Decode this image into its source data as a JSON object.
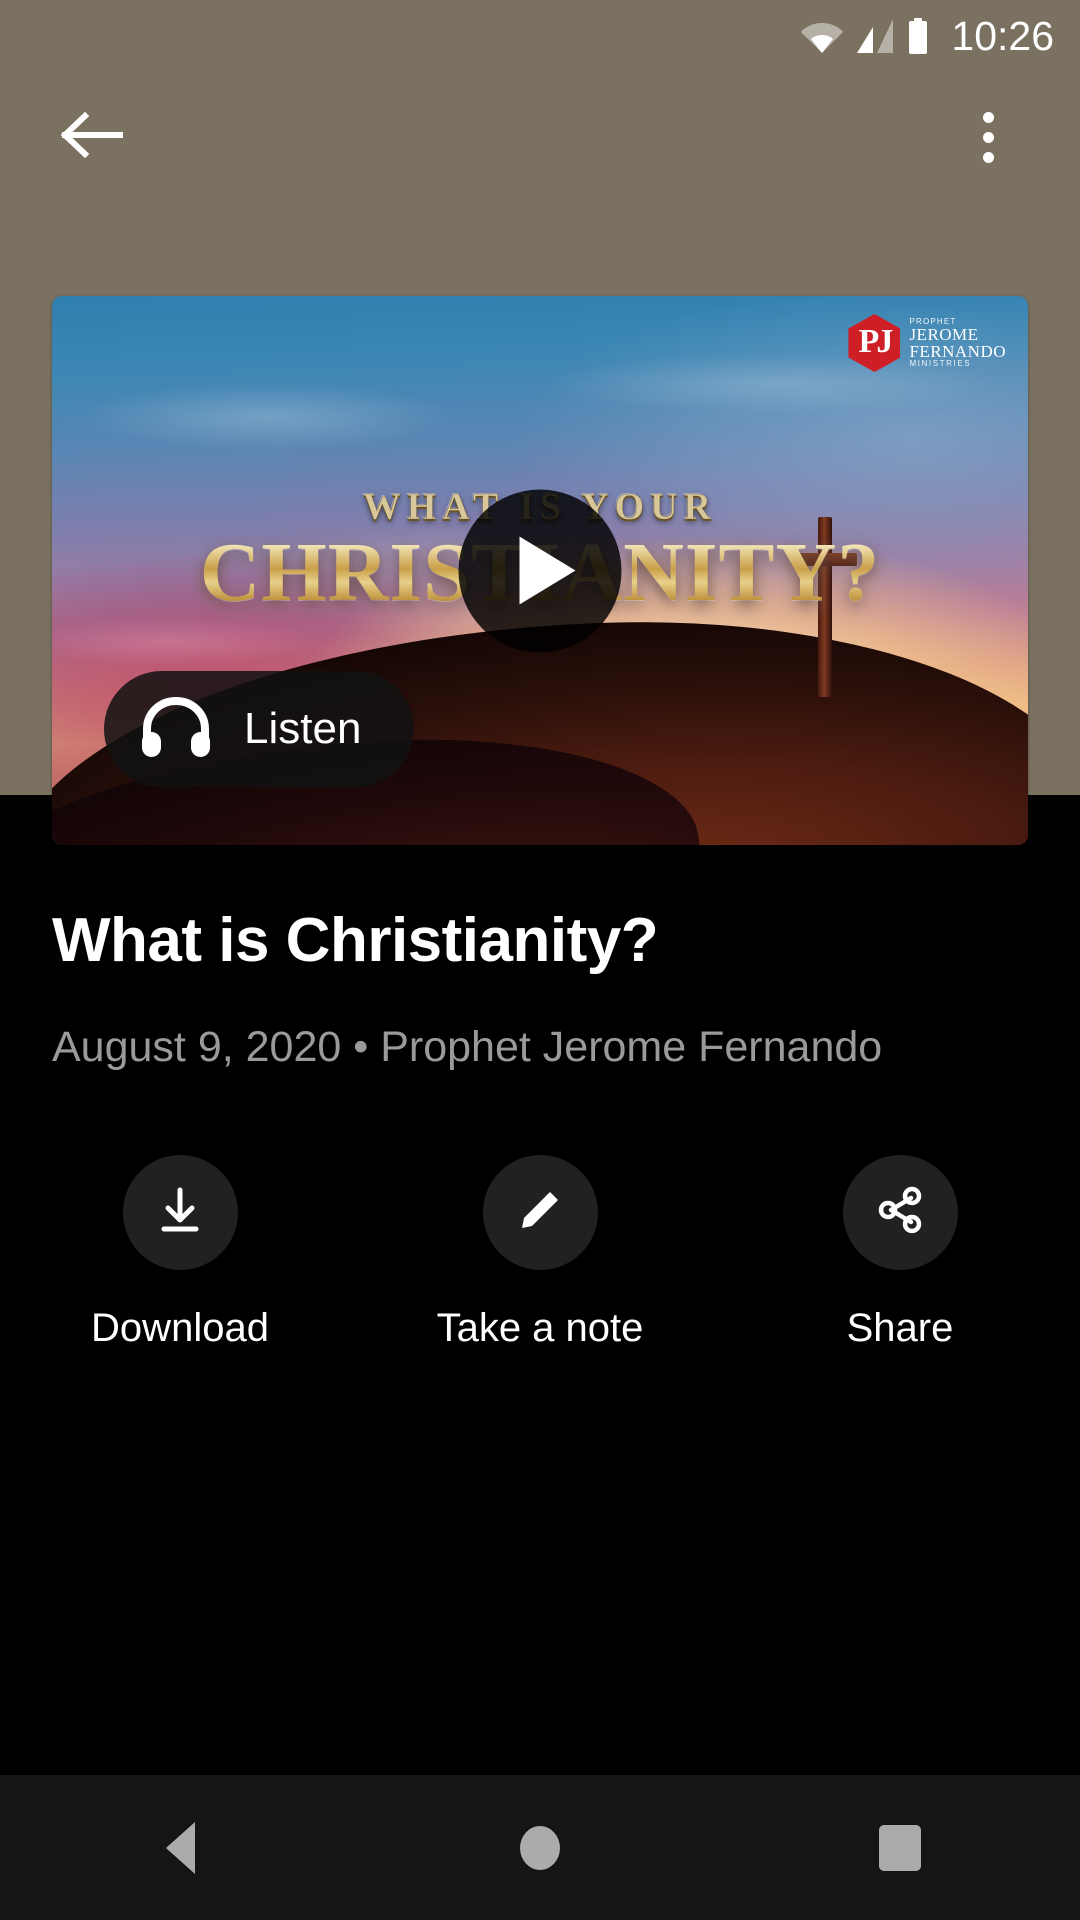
{
  "status_bar": {
    "time": "10:26",
    "icons": [
      "wifi-icon",
      "cellular-signal-icon",
      "battery-icon"
    ]
  },
  "app_bar": {
    "back_label": "Back",
    "back_icon": "arrow-left-icon",
    "overflow_icon": "more-vertical-icon",
    "overflow_label": "More options"
  },
  "video": {
    "play_icon": "play-icon",
    "play_label": "Play",
    "listen_label": "Listen",
    "listen_icon": "headphones-icon",
    "thumbnail": {
      "kicker": "WHAT IS YOUR",
      "headline": "CHRISTIANITY?",
      "logo": {
        "monogram": "PJ",
        "line1": "PROPHET",
        "line2": "JEROME",
        "line3": "FERNANDO",
        "line4": "MINISTRIES",
        "badge_color": "#cf1f26"
      }
    }
  },
  "detail": {
    "title": "What is Christianity?",
    "meta": "August 9, 2020 • Prophet Jerome Fernando",
    "date": "August 9, 2020",
    "speaker": "Prophet Jerome Fernando"
  },
  "actions": [
    {
      "label": "Download",
      "icon": "download-icon"
    },
    {
      "label": "Take a note",
      "icon": "pencil-icon"
    },
    {
      "label": "Share",
      "icon": "share-icon"
    }
  ],
  "nav_bar": {
    "back_label": "Back",
    "home_label": "Home",
    "recents_label": "Recents"
  },
  "colors": {
    "scrim": "#7a7160",
    "sheet": "#000000",
    "action_circle": "#212121",
    "meta_text": "#9a9a9a",
    "nav_bar": "#151515",
    "nav_icon": "#ababab"
  }
}
